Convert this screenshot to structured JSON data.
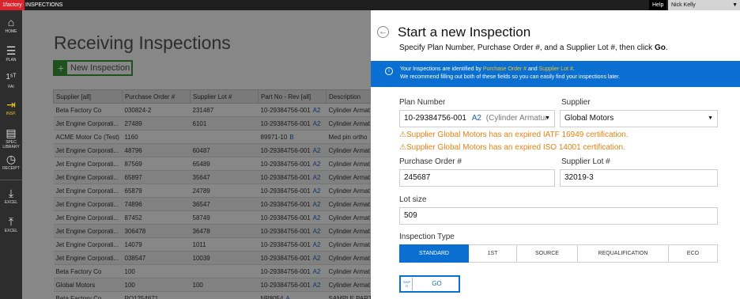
{
  "topbar": {
    "brand": "1factory",
    "title": "INSPECTIONS",
    "help_label": "Help",
    "user_name": "Nick Kelly"
  },
  "sidebar": {
    "items": [
      {
        "icon": "home-icon",
        "glyph": "⌂",
        "label": "HOME"
      },
      {
        "icon": "plan-icon",
        "glyph": "☰",
        "label": "PLAN"
      },
      {
        "icon": "first-article-icon",
        "glyph": "1ˢᵀ",
        "label": "FAI"
      },
      {
        "icon": "inspection-icon",
        "glyph": "⇥",
        "label": "INSP.",
        "active": true
      },
      {
        "icon": "spec-library-icon",
        "glyph": "▤",
        "label": "SPEC LIBRARY"
      },
      {
        "icon": "receipt-icon",
        "glyph": "◷",
        "label": "RECEIPT"
      },
      {
        "icon": "excel-download-icon",
        "glyph": "⤓",
        "label": "EXCEL"
      },
      {
        "icon": "excel-upload-icon",
        "glyph": "⤒",
        "label": "EXCEL"
      }
    ]
  },
  "background": {
    "page_title": "Receiving Inspections",
    "new_button_label": "New Inspection",
    "columns": [
      "Supplier [all]",
      "Purchase Order #",
      "Supplier Lot #",
      "Part No - Rev [all]",
      "Description"
    ],
    "rows": [
      {
        "supplier": "Beta Factory Co",
        "po": "030824-2",
        "lot": "231487",
        "part": "10-29384756-001",
        "rev": "A2",
        "desc": "Cylinder Armat"
      },
      {
        "supplier": "Jet Engine Corporati...",
        "po": "27489",
        "lot": "6101",
        "part": "10-29384756-001",
        "rev": "A2",
        "desc": "Cylinder Armat"
      },
      {
        "supplier": "ACME Motor Co (Test)",
        "po": "1160",
        "lot": "",
        "part": "89971-10",
        "rev": "B",
        "desc": "Med pin ortho"
      },
      {
        "supplier": "Jet Engine Corporati...",
        "po": "48796",
        "lot": "60487",
        "part": "10-29384756-001",
        "rev": "A2",
        "desc": "Cylinder Armat"
      },
      {
        "supplier": "Jet Engine Corporati...",
        "po": "87569",
        "lot": "65489",
        "part": "10-29384756-001",
        "rev": "A2",
        "desc": "Cylinder Armat"
      },
      {
        "supplier": "Jet Engine Corporati...",
        "po": "65897",
        "lot": "35647",
        "part": "10-29384756-001",
        "rev": "A2",
        "desc": "Cylinder Armat"
      },
      {
        "supplier": "Jet Engine Corporati...",
        "po": "65879",
        "lot": "24789",
        "part": "10-29384756-001",
        "rev": "A2",
        "desc": "Cylinder Armat"
      },
      {
        "supplier": "Jet Engine Corporati...",
        "po": "74896",
        "lot": "36547",
        "part": "10-29384756-001",
        "rev": "A2",
        "desc": "Cylinder Armat"
      },
      {
        "supplier": "Jet Engine Corporati...",
        "po": "87452",
        "lot": "58749",
        "part": "10-29384756-001",
        "rev": "A2",
        "desc": "Cylinder Armat"
      },
      {
        "supplier": "Jet Engine Corporati...",
        "po": "306478",
        "lot": "36478",
        "part": "10-29384756-001",
        "rev": "A2",
        "desc": "Cylinder Armat"
      },
      {
        "supplier": "Jet Engine Corporati...",
        "po": "14079",
        "lot": "1011",
        "part": "10-29384756-001",
        "rev": "A2",
        "desc": "Cylinder Armat"
      },
      {
        "supplier": "Jet Engine Corporati...",
        "po": "038547",
        "lot": "10039",
        "part": "10-29384756-001",
        "rev": "A2",
        "desc": "Cylinder Armat"
      },
      {
        "supplier": "Beta Factory Co",
        "po": "100",
        "lot": "",
        "part": "10-29384756-001",
        "rev": "A2",
        "desc": "Cylinder Armat"
      },
      {
        "supplier": "Global Motors",
        "po": "100",
        "lot": "100",
        "part": "10-29384756-001",
        "rev": "A2",
        "desc": "Cylinder Armat"
      },
      {
        "supplier": "Beta Factory Co",
        "po": "PO1254671",
        "lot": "",
        "part": "NP8054",
        "rev": "A",
        "desc": "SAMPLE PART A"
      }
    ]
  },
  "modal": {
    "title": "Start a new Inspection",
    "subtitle_prefix": "Specify Plan Number, Purchase Order #, and a Supplier Lot #, then click ",
    "subtitle_bold": "Go",
    "subtitle_suffix": ".",
    "info_line1_prefix": "Your Inspections are identified by ",
    "info_po": "Purchase Order #",
    "info_and": " and ",
    "info_lot": "Supplier Lot #",
    "info_line1_suffix": ".",
    "info_line2": "We recommend filling out both of these fields so you can easily find your inspections later.",
    "plan_label": "Plan Number",
    "plan_value": "10-29384756-001",
    "plan_rev": "A2",
    "plan_desc": "(Cylinder Armatur",
    "supplier_label": "Supplier",
    "supplier_value": "Global Motors",
    "warning1": "⚠Supplier Global Motors has an expired IATF 16949 certification.",
    "warning2": "⚠Supplier Global Motors has an expired ISO 14001 certification.",
    "po_label": "Purchase Order #",
    "po_value": "245687",
    "lot_label": "Supplier Lot #",
    "lot_value": "32019-3",
    "lotsize_label": "Lot size",
    "lotsize_value": "509",
    "type_label": "Inspection Type",
    "types": [
      "STANDARD",
      "1ST",
      "SOURCE",
      "REQUALIFICATION",
      "ECO"
    ],
    "selected_type": "STANDARD",
    "go_icon_text": "SHIP G",
    "go_label": "GO"
  },
  "colors": {
    "accent_blue": "#0a6fd1",
    "warning_orange": "#e8820e",
    "brand_red": "#d9232d",
    "active_nav_yellow": "#f2c31f",
    "new_button_green": "#3a9a3a"
  }
}
